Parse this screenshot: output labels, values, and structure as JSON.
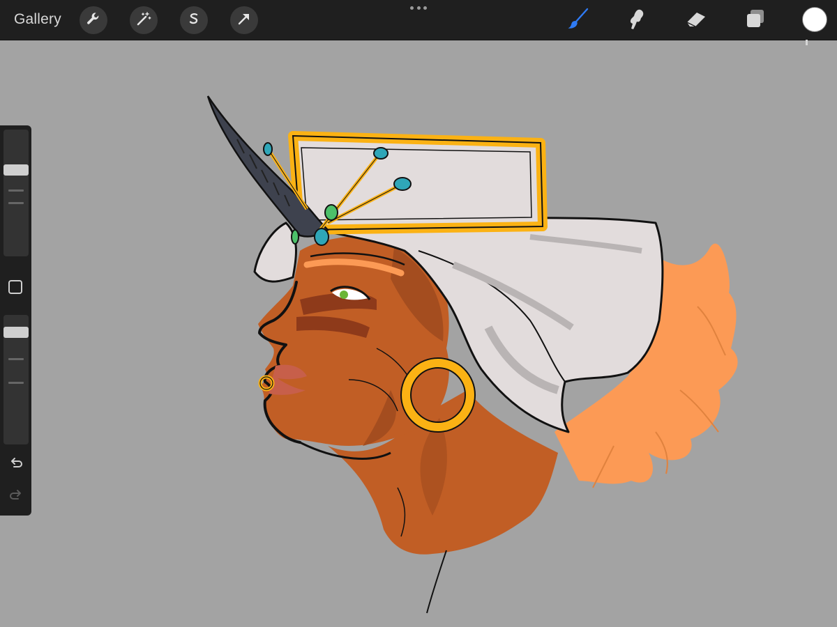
{
  "topbar": {
    "gallery_label": "Gallery",
    "left_tools": [
      "wrench-icon",
      "magic-wand-icon",
      "selection-icon",
      "transform-arrow-icon"
    ],
    "right_tools": [
      "brush-icon",
      "smudge-icon",
      "eraser-icon",
      "layers-icon"
    ],
    "active_tool": "brush-icon",
    "active_color": "#ffffff",
    "accent_color": "#2f7bf5"
  },
  "sidebar": {
    "brush_size_level": 0.3,
    "opacity_level": 0.1,
    "modify_button_icon": "square-icon",
    "undo_icon": "undo-icon",
    "redo_icon": "redo-icon"
  },
  "canvas": {
    "background_color": "#a3a3a3",
    "artwork_subject": "character-profile-sketch",
    "palette": {
      "skin": "#c15e25",
      "skin_shadow": "#9e4a1e",
      "hair": "#fc9a55",
      "headwrap": "#e2dcdc",
      "headwrap_shadow": "#b9b4b4",
      "gold": "#fbb214",
      "horn": "#3e424e",
      "gem": "#2fa6b8",
      "lip": "#c75f4a",
      "line": "#111111"
    }
  }
}
